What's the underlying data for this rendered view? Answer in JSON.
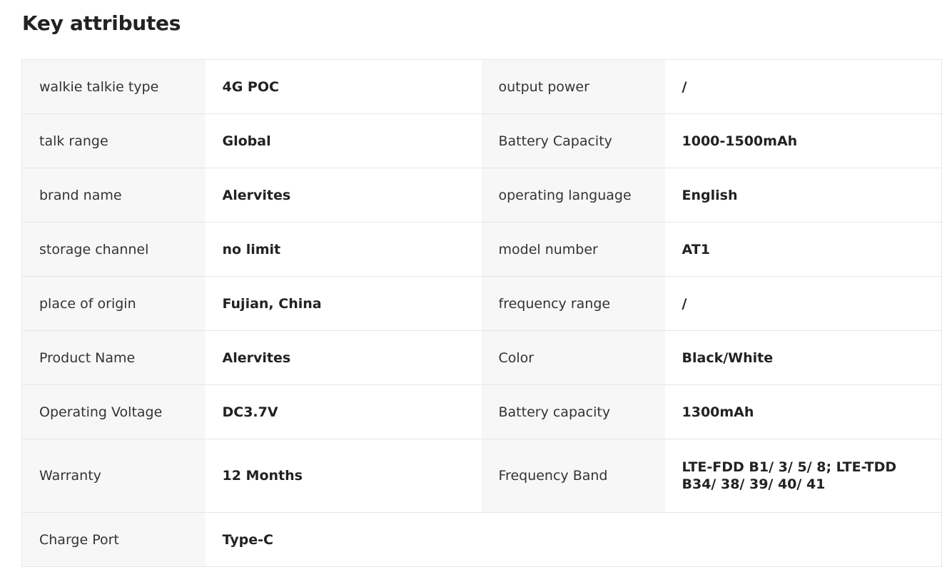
{
  "section": {
    "title": "Key attributes"
  },
  "rows": [
    {
      "k1": "walkie talkie type",
      "v1": "4G POC",
      "k2": "output power",
      "v2": "/"
    },
    {
      "k1": "talk range",
      "v1": "Global",
      "k2": "Battery Capacity",
      "v2": "1000-1500mAh"
    },
    {
      "k1": "brand name",
      "v1": "Alervites",
      "k2": "operating language",
      "v2": "English"
    },
    {
      "k1": "storage channel",
      "v1": "no limit",
      "k2": "model number",
      "v2": "AT1"
    },
    {
      "k1": "place of origin",
      "v1": "Fujian, China",
      "k2": "frequency range",
      "v2": "/"
    },
    {
      "k1": "Product Name",
      "v1": "Alervites",
      "k2": "Color",
      "v2": "Black/White"
    },
    {
      "k1": "Operating Voltage",
      "v1": "DC3.7V",
      "k2": "Battery capacity",
      "v2": "1300mAh"
    },
    {
      "k1": "Warranty",
      "v1": "12 Months",
      "k2": "Frequency Band",
      "v2": "LTE-FDD B1/ 3/ 5/ 8; LTE-TDD B34/ 38/ 39/ 40/ 41"
    },
    {
      "k1": "Charge Port",
      "v1": "Type-C",
      "k2": "",
      "v2": ""
    }
  ]
}
